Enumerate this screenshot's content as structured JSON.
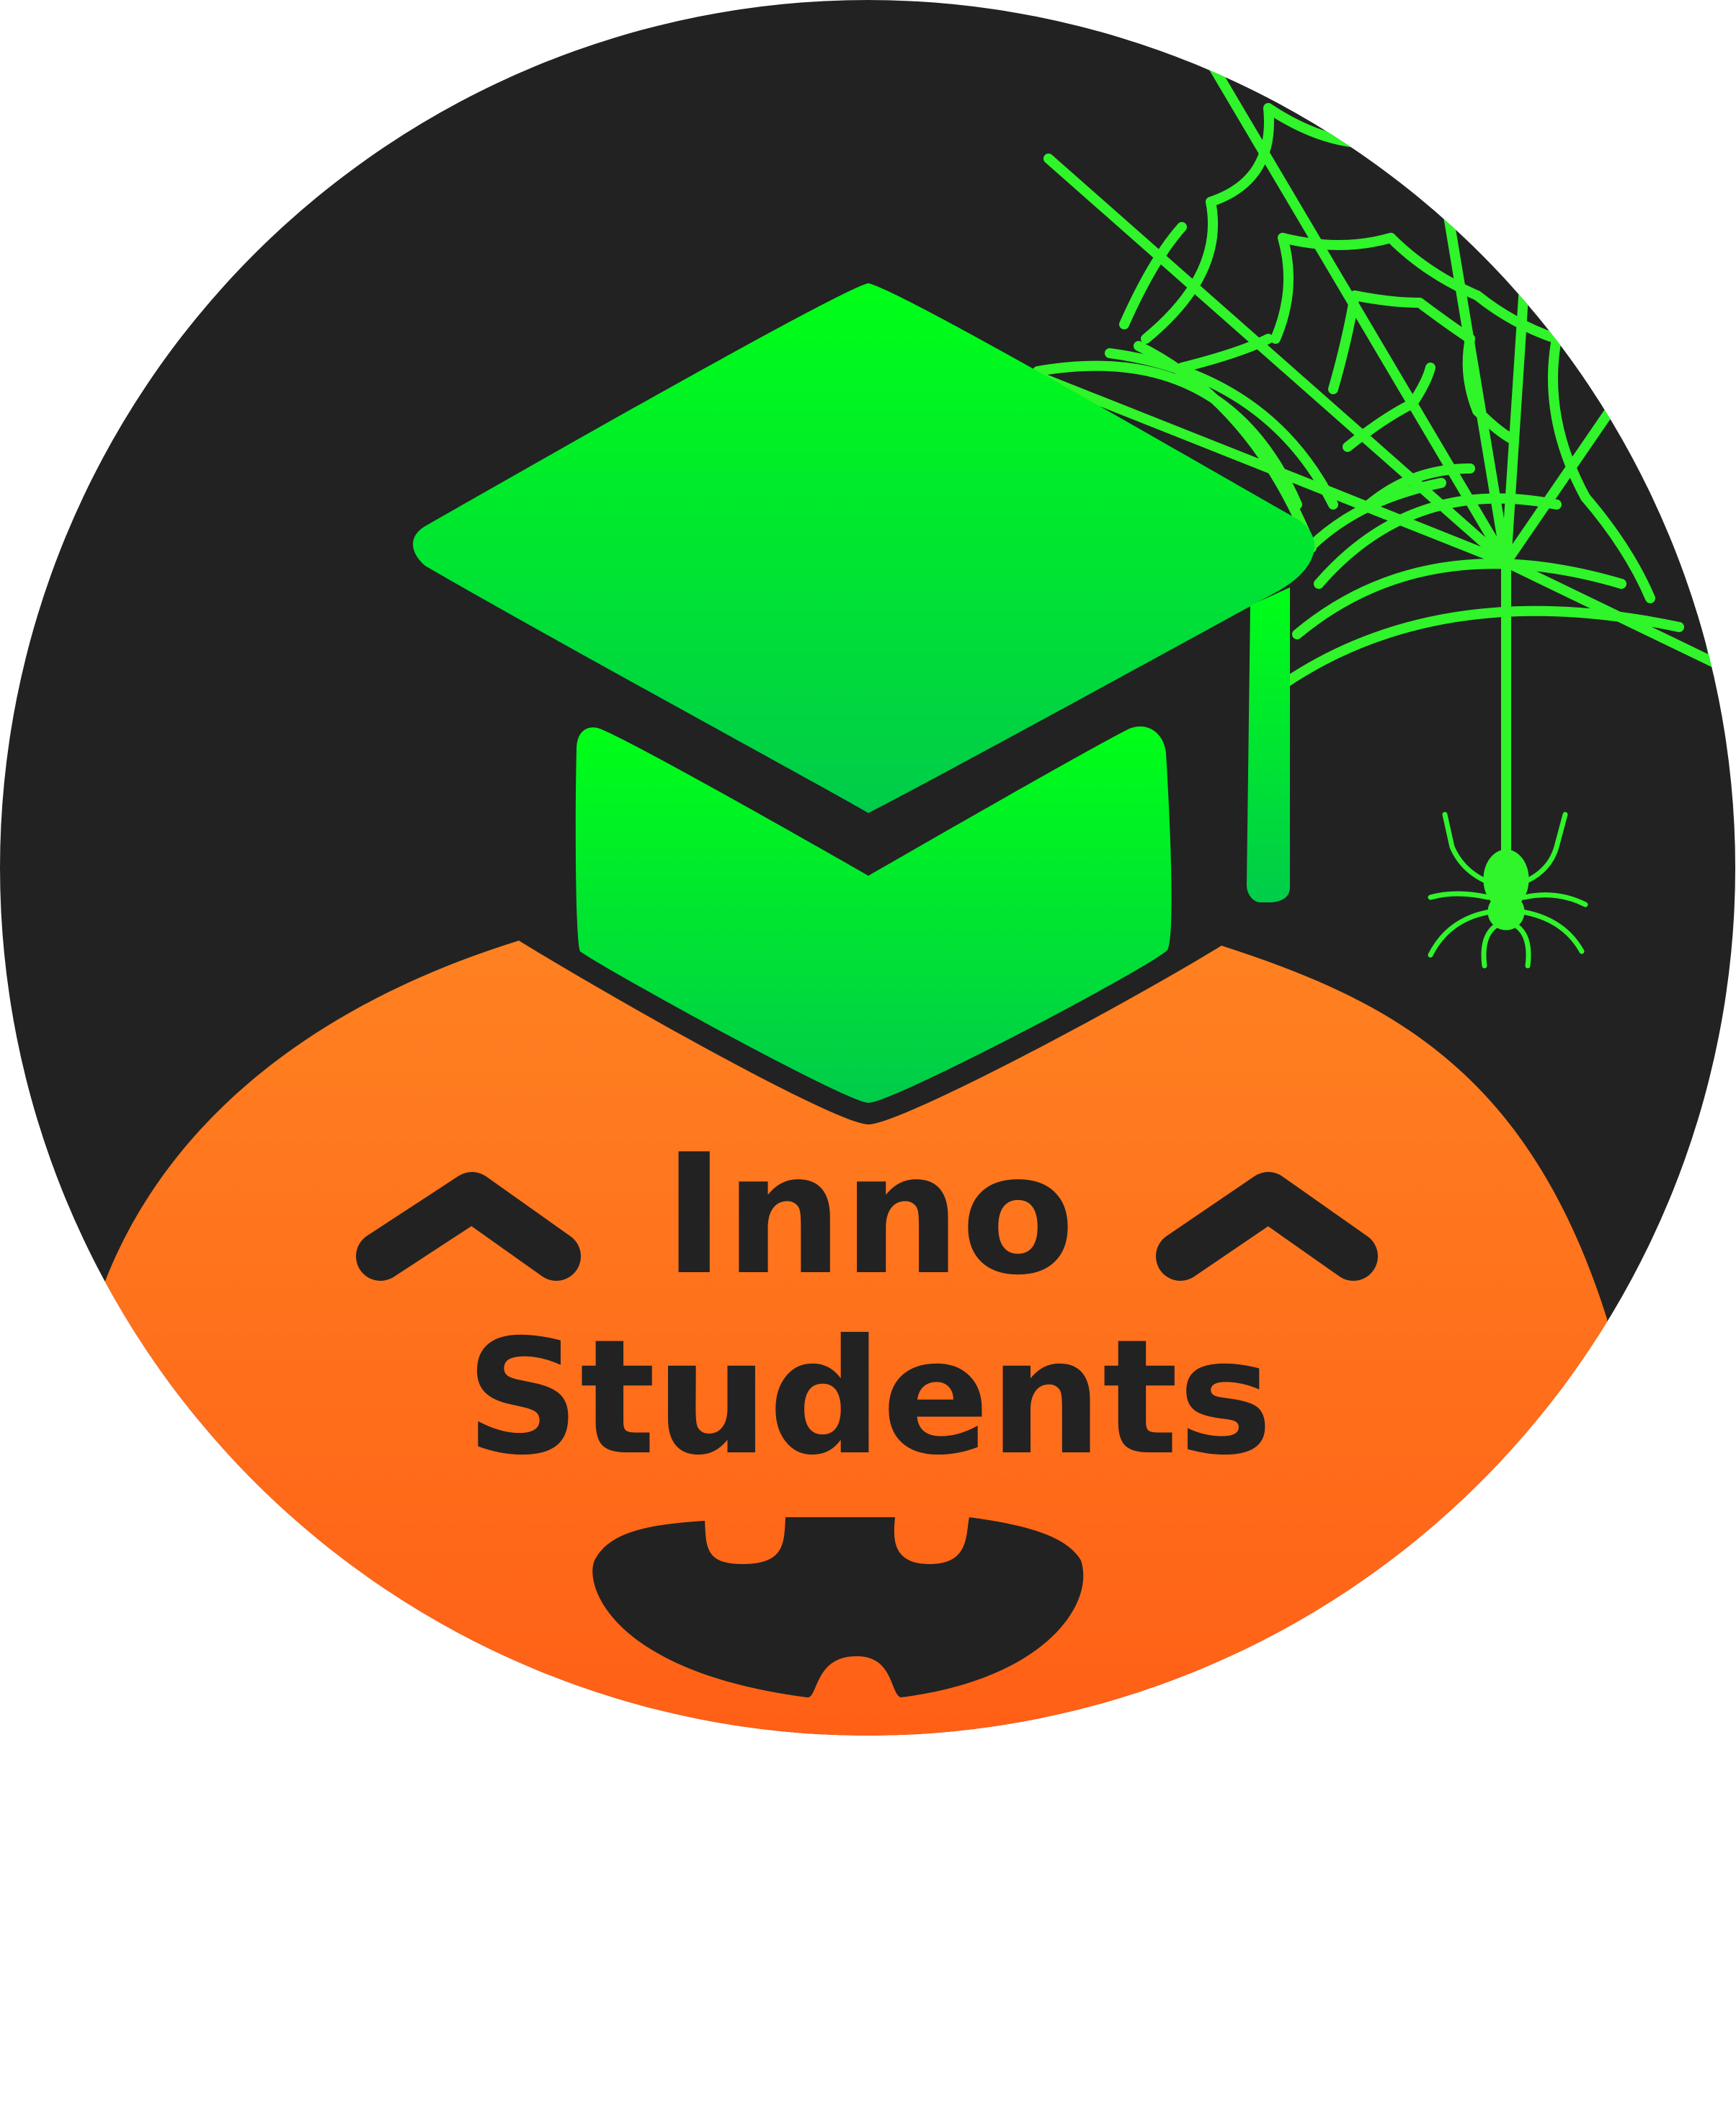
{
  "logo": {
    "line1": "Inno",
    "line2": "Students",
    "colors": {
      "background_circle": "#222222",
      "pumpkin_top": "#FF8121",
      "pumpkin_bottom": "#FF5A14",
      "cap_top": "#00FF17",
      "cap_bottom": "#00CC4A",
      "web": "#2FF52A",
      "text": "#222222",
      "page": "#FFFFFF"
    },
    "icons": [
      "graduation-cap-icon",
      "spider-web-icon",
      "spider-icon",
      "pumpkin-face-icon"
    ]
  }
}
